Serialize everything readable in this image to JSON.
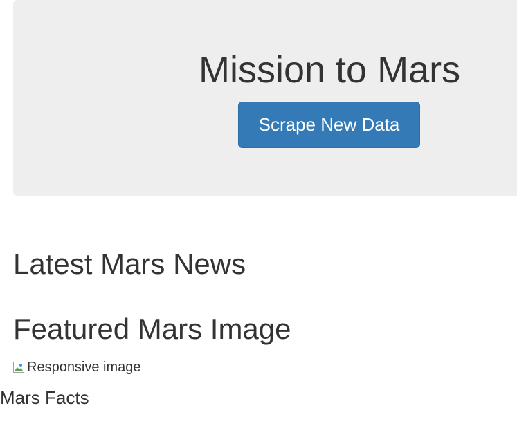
{
  "header": {
    "title": "Mission to Mars",
    "scrape_button_label": "Scrape New Data"
  },
  "sections": {
    "news_heading": "Latest Mars News",
    "featured_image_heading": "Featured Mars Image",
    "featured_image_alt": "Responsive image",
    "facts_heading": "Mars Facts"
  },
  "icons": {
    "broken_image": "broken-image-icon"
  },
  "colors": {
    "jumbotron_bg": "#eeeeee",
    "primary_button": "#337ab7",
    "text": "#333333"
  }
}
